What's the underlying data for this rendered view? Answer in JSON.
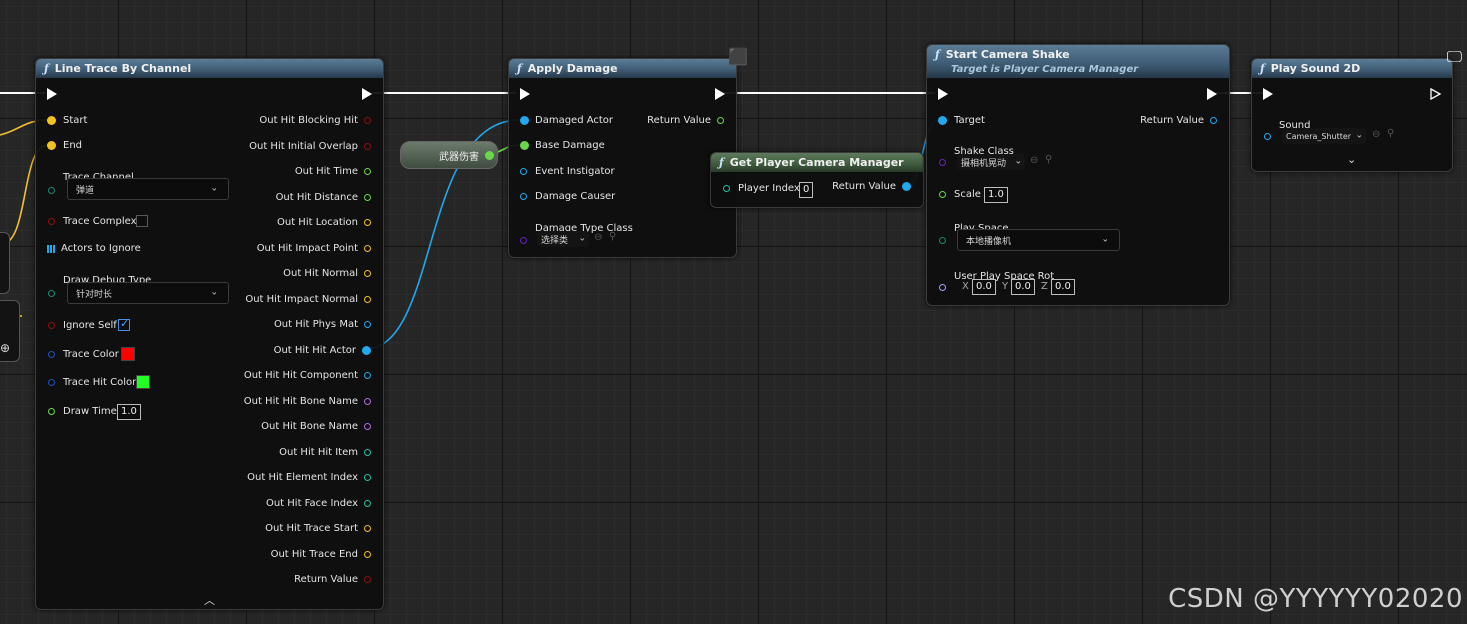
{
  "nodes": {
    "line_trace": {
      "title": "Line Trace By Channel",
      "inputs": {
        "start": "Start",
        "end": "End",
        "trace_channel": "Trace Channel",
        "trace_channel_value": "弹道",
        "trace_complex": "Trace Complex",
        "actors_to_ignore": "Actors to Ignore",
        "draw_debug_type": "Draw Debug Type",
        "draw_debug_type_value": "针对时长",
        "ignore_self": "Ignore Self",
        "trace_color": "Trace Color",
        "trace_hit_color": "Trace Hit Color",
        "draw_time": "Draw Time",
        "draw_time_value": "1.0"
      },
      "outputs": [
        "Out Hit Blocking Hit",
        "Out Hit Initial Overlap",
        "Out Hit Time",
        "Out Hit Distance",
        "Out Hit Location",
        "Out Hit Impact Point",
        "Out Hit Normal",
        "Out Hit Impact Normal",
        "Out Hit Phys Mat",
        "Out Hit Hit Actor",
        "Out Hit Hit Component",
        "Out Hit Hit Bone Name",
        "Out Hit Bone Name",
        "Out Hit Hit Item",
        "Out Hit Element Index",
        "Out Hit Face Index",
        "Out Hit Trace Start",
        "Out Hit Trace End",
        "Return Value"
      ],
      "colors": {
        "trace_color": "#ff0000",
        "trace_hit_color": "#22ff22"
      }
    },
    "variable": {
      "label": "武器伤害"
    },
    "apply_damage": {
      "title": "Apply Damage",
      "inputs": {
        "damaged_actor": "Damaged Actor",
        "base_damage": "Base Damage",
        "event_instigator": "Event Instigator",
        "damage_causer": "Damage Causer",
        "damage_type_class": "Damage Type Class",
        "damage_type_value": "选择类"
      },
      "return_value": "Return Value"
    },
    "get_camera_manager": {
      "title": "Get Player Camera Manager",
      "player_index": "Player Index",
      "player_index_value": "0",
      "return_value": "Return Value"
    },
    "camera_shake": {
      "title": "Start Camera Shake",
      "subtitle": "Target is Player Camera Manager",
      "target": "Target",
      "return_value": "Return Value",
      "shake_class": "Shake Class",
      "shake_class_value": "摄相机晃动",
      "scale": "Scale",
      "scale_value": "1.0",
      "play_space": "Play Space",
      "play_space_value": "本地播像机",
      "user_play_space_rot": "User Play Space Rot",
      "rot_x_label": "X",
      "rot_x": "0.0",
      "rot_y_label": "Y",
      "rot_y": "0.0",
      "rot_z_label": "Z",
      "rot_z": "0.0"
    },
    "play_sound": {
      "title": "Play Sound 2D",
      "sound": "Sound",
      "sound_value": "Camera_Shutter"
    }
  },
  "watermark": "CSDN @YYYYYY02020"
}
